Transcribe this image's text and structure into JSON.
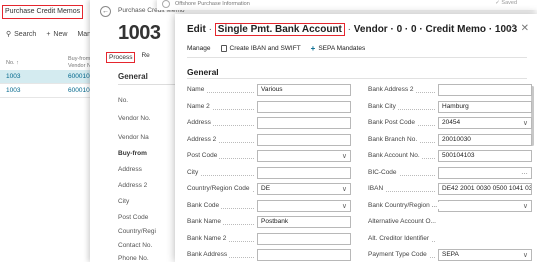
{
  "list_page": {
    "title": "Purchase Credit Memos",
    "tools": {
      "search": "Search",
      "new": "New",
      "manage": "Manag"
    },
    "columns": {
      "no": "No. ↑",
      "vendor": "Buy-from Vendor No."
    },
    "rows": [
      {
        "no": "1003",
        "vendor": "600010"
      },
      {
        "no": "1003",
        "vendor": "600010"
      }
    ]
  },
  "card_page": {
    "breadcrumb": "Purchase Credit Memo",
    "number": "1003",
    "actions": {
      "process": "Process",
      "re": "Re"
    },
    "section": "General",
    "labels": [
      "No.",
      "Vendor No.",
      "Vendor Na",
      "Buy-from",
      "Address",
      "Address 2",
      "City",
      "Post Code",
      "Country/Regi",
      "Contact No.",
      "Phone No."
    ]
  },
  "back_page": {
    "breadcrumb": "Offshore Purchase Information",
    "saved": "✓ Saved"
  },
  "dialog": {
    "title_prefix": "Edit",
    "title_highlight": "Single Pmt. Bank Account",
    "title_suffix": "Vendor · 0 · 0 · Credit Memo · 1003",
    "actions": {
      "manage": "Manage",
      "create_iban": "Create IBAN and SWIFT",
      "sepa": "SEPA Mandates"
    },
    "section": "General",
    "left_fields": [
      {
        "label": "Name",
        "value": "Various",
        "type": "text"
      },
      {
        "label": "Name 2",
        "value": "",
        "type": "text"
      },
      {
        "label": "Address",
        "value": "",
        "type": "text"
      },
      {
        "label": "Address 2",
        "value": "",
        "type": "text"
      },
      {
        "label": "Post Code",
        "value": "",
        "type": "select"
      },
      {
        "label": "City",
        "value": "",
        "type": "text"
      },
      {
        "label": "Country/Region Code",
        "value": "DE",
        "type": "select"
      },
      {
        "label": "Bank Code",
        "value": "",
        "type": "select"
      },
      {
        "label": "Bank Name",
        "value": "Postbank",
        "type": "text"
      },
      {
        "label": "Bank Name 2",
        "value": "",
        "type": "text"
      },
      {
        "label": "Bank Address",
        "value": "",
        "type": "text"
      }
    ],
    "right_fields": [
      {
        "label": "Bank Address 2",
        "value": "",
        "type": "text"
      },
      {
        "label": "Bank City",
        "value": "Hamburg",
        "type": "text"
      },
      {
        "label": "Bank Post Code",
        "value": "20454",
        "type": "select"
      },
      {
        "label": "Bank Branch No.",
        "value": "20010030",
        "type": "text"
      },
      {
        "label": "Bank Account No.",
        "value": "500104103",
        "type": "text"
      },
      {
        "label": "BIC-Code",
        "value": "",
        "type": "lookup"
      },
      {
        "label": "IBAN",
        "value": "DE42 2001 0030 0500 1041 03",
        "type": "text"
      },
      {
        "label": "Bank Country/Region ...",
        "value": "",
        "type": "select"
      },
      {
        "label": "Alternative Account O...",
        "value": "",
        "type": "plain"
      },
      {
        "label": "Alt. Creditor Identifier",
        "value": "",
        "type": "plain"
      },
      {
        "label": "Payment Type Code",
        "value": "SEPA",
        "type": "select"
      }
    ]
  }
}
